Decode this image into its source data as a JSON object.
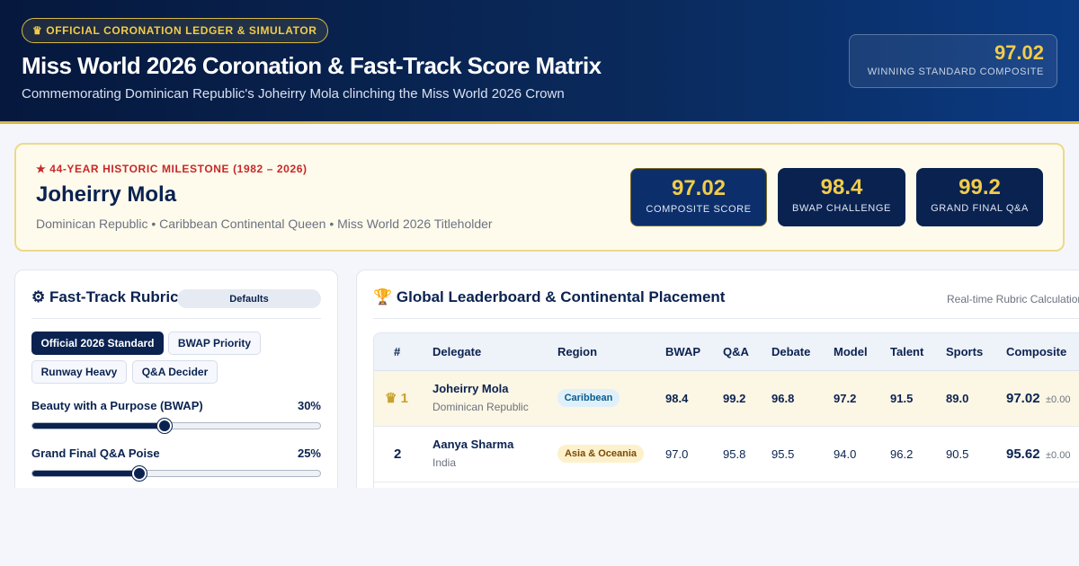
{
  "header": {
    "badge_icon": "crown-icon",
    "badge": "♛ OFFICIAL CORONATION LEDGER & SIMULATOR",
    "title": "Miss World 2026 Coronation & Fast-Track Score Matrix",
    "subtitle": "Commemorating Dominican Republic's Joheirry Mola clinching the Miss World 2026 Crown",
    "winning_value": "97.02",
    "winning_label": "WINNING STANDARD COMPOSITE"
  },
  "winner": {
    "milestone": "★ 44-YEAR HISTORIC MILESTONE (1982 – 2026)",
    "name": "Joheirry Mola",
    "subtitle": "Dominican Republic • Caribbean Continental Queen • Miss World 2026 Titleholder",
    "stats": [
      {
        "value": "97.02",
        "label": "COMPOSITE SCORE"
      },
      {
        "value": "98.4",
        "label": "BWAP CHALLENGE"
      },
      {
        "value": "99.2",
        "label": "GRAND FINAL Q&A"
      }
    ]
  },
  "rubric": {
    "title": "⚙ Fast-Track Rubric",
    "title_icon": "gear-icon",
    "defaults_label": "Defaults",
    "presets": [
      "Official 2026 Standard",
      "BWAP Priority",
      "Runway Heavy",
      "Q&A Decider"
    ],
    "active_preset": "Official 2026 Standard",
    "sliders": [
      {
        "label": "Beauty with a Purpose (BWAP)",
        "pct_label": "30%",
        "value": 0.458
      },
      {
        "label": "Grand Final Q&A Poise",
        "pct_label": "25%",
        "value": 0.371
      }
    ]
  },
  "leaderboard": {
    "title": "🏆 Global Leaderboard & Continental Placement",
    "title_icon": "trophy-icon",
    "realtime_label": "Real-time Rubric Calculation",
    "columns": [
      "#",
      "Delegate",
      "Region",
      "BWAP",
      "Q&A",
      "Debate",
      "Model",
      "Talent",
      "Sports",
      "Composite"
    ],
    "rows": [
      {
        "rank": "♛ 1",
        "name": "Joheirry Mola",
        "country": "Dominican Republic",
        "region": "Caribbean",
        "bwap": "98.4",
        "qa": "99.2",
        "debate": "96.8",
        "model": "97.2",
        "talent": "91.5",
        "sports": "89.0",
        "composite": "97.02",
        "delta": "±0.00"
      },
      {
        "rank": "2",
        "name": "Aanya Sharma",
        "country": "India",
        "region": "Asia & Oceania",
        "bwap": "97.0",
        "qa": "95.8",
        "debate": "95.5",
        "model": "94.0",
        "talent": "96.2",
        "sports": "90.5",
        "composite": "95.62",
        "delta": "±0.00"
      }
    ]
  },
  "colors": {
    "navy": "#0a2250",
    "gold": "#f2cc4a",
    "milestone_red": "#c62828",
    "caribbean_pill": "#dff0fb",
    "asia_pill": "#fdf1cc"
  }
}
